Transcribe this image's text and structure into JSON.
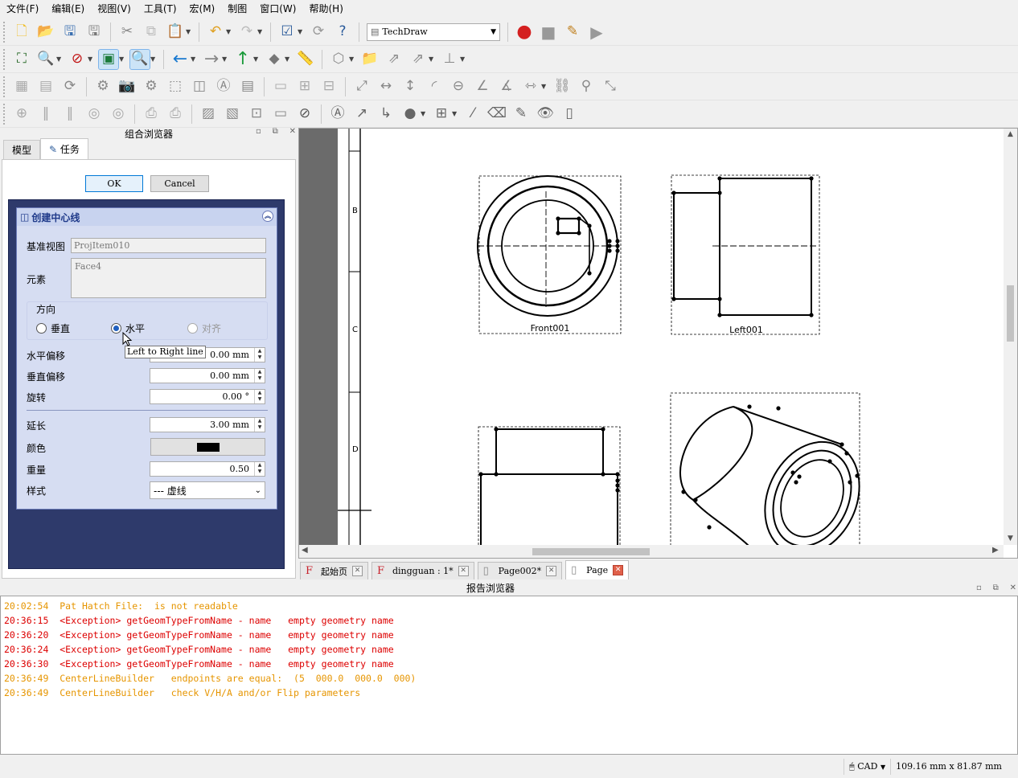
{
  "menu": [
    "文件(F)",
    "编辑(E)",
    "视图(V)",
    "工具(T)",
    "宏(M)",
    "制图",
    "窗口(W)",
    "帮助(H)"
  ],
  "toolbar": {
    "workbench": "TechDraw",
    "row1": [
      "new-file-icon",
      "open-file-icon",
      "save-icon",
      "save-as-icon",
      "cut-icon",
      "copy-icon",
      "paste-icon",
      "undo-icon",
      "redo-icon",
      "refresh-icon",
      "whats-this-icon"
    ],
    "row2": [
      "fit-all-icon",
      "zoom-icon",
      "draw-style-icon",
      "bounding-box-icon",
      "zoom-select-icon",
      "back-icon",
      "forward-icon",
      "up-icon",
      "std-view-icon",
      "measure-icon",
      "part-icon",
      "folder-icon",
      "link-icon",
      "link-make-icon",
      "axis-icon"
    ]
  },
  "left_panel": {
    "title": "组合浏览器",
    "tabs": [
      "模型",
      "任务"
    ],
    "ok_label": "OK",
    "cancel_label": "Cancel",
    "taskbox": {
      "title": "创建中心线",
      "base_view_label": "基准视图",
      "base_view_value": "ProjItem010",
      "elements_label": "元素",
      "elements_value": "Face4",
      "orientation_label": "方向",
      "orientation_options": [
        "垂直",
        "水平",
        "对齐"
      ],
      "orientation_selected": "水平",
      "tooltip": "Left to Right line",
      "h_offset_label": "水平偏移",
      "h_offset_value": "0.00 mm",
      "v_offset_label": "垂直偏移",
      "v_offset_value": "0.00 mm",
      "rotate_label": "旋转",
      "rotate_value": "0.00 °",
      "extend_label": "延长",
      "extend_value": "3.00 mm",
      "color_label": "颜色",
      "color_value": "#000000",
      "weight_label": "重量",
      "weight_value": "0.50",
      "style_label": "样式",
      "style_value": "--- 虚线"
    }
  },
  "drawing": {
    "zone_labels": [
      "B",
      "C",
      "D"
    ],
    "view_labels": [
      "Front001",
      "Left001"
    ]
  },
  "doc_tabs": [
    {
      "label": "起始页",
      "icon": "freecad-icon"
    },
    {
      "label": "dingguan : 1*",
      "icon": "freecad-icon"
    },
    {
      "label": "Page002*",
      "icon": "page-icon"
    },
    {
      "label": "Page",
      "icon": "page-icon",
      "active": true
    }
  ],
  "report": {
    "title": "报告浏览器",
    "lines": [
      {
        "t": "20:02:54",
        "msg": "Pat Hatch File:  is not readable",
        "level": "warn"
      },
      {
        "t": "20:36:15",
        "msg": "<Exception> getGeomTypeFromName - name   empty geometry name",
        "level": "err"
      },
      {
        "t": "20:36:20",
        "msg": "<Exception> getGeomTypeFromName - name   empty geometry name",
        "level": "err"
      },
      {
        "t": "20:36:24",
        "msg": "<Exception> getGeomTypeFromName - name   empty geometry name",
        "level": "err"
      },
      {
        "t": "20:36:30",
        "msg": "<Exception> getGeomTypeFromName - name   empty geometry name",
        "level": "err"
      },
      {
        "t": "20:36:49",
        "msg": "CenterLineBuilder   endpoints are equal:  (5  000.0  000.0  000)",
        "level": "warn"
      },
      {
        "t": "20:36:49",
        "msg": "CenterLineBuilder   check V/H/A and/or Flip parameters",
        "level": "warn"
      }
    ]
  },
  "status": {
    "nav_style": "CAD",
    "dimensions": "109.16 mm x 81.87 mm"
  }
}
